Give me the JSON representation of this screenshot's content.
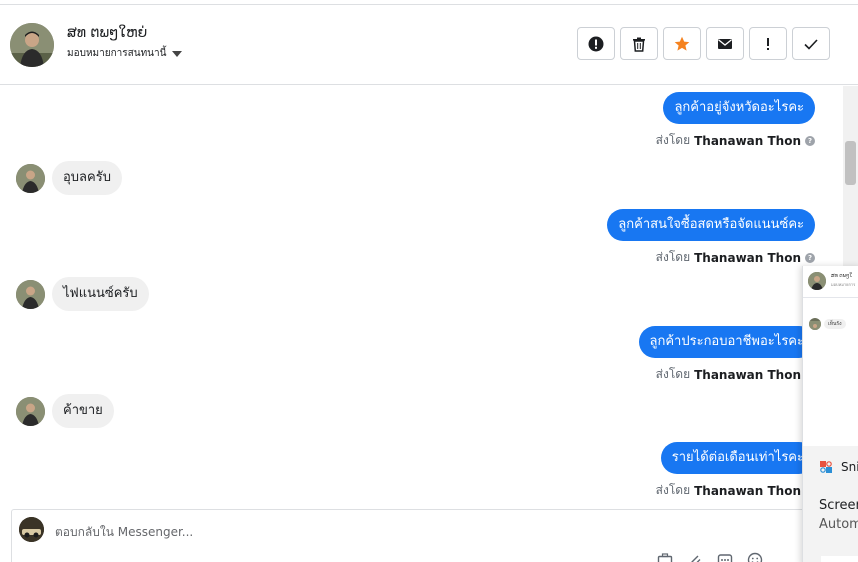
{
  "header": {
    "contact_name": "ສທ ຕພໆໃຫຍ່",
    "assign_label": "มอบหมายการสนทนานี้"
  },
  "actions": [
    {
      "name": "spam-button",
      "icon": "alert-circle-icon"
    },
    {
      "name": "delete-button",
      "icon": "trash-icon"
    },
    {
      "name": "star-button",
      "icon": "star-icon",
      "color": "#f5821f"
    },
    {
      "name": "mark-unread-button",
      "icon": "envelope-icon"
    },
    {
      "name": "follow-up-button",
      "icon": "exclamation-icon"
    },
    {
      "name": "mark-done-button",
      "icon": "check-icon"
    }
  ],
  "messages": [
    {
      "dir": "out",
      "text": "ลูกค้าอยู่จังหวัดอะไรคะ",
      "sent_prefix": "ส่งโดย",
      "sender": "Thanawan Thon"
    },
    {
      "dir": "in",
      "text": "อุบลครับ"
    },
    {
      "dir": "out",
      "text": "ลูกค้าสนใจซื้อสดหรือจัดแนนซ์คะ",
      "sent_prefix": "ส่งโดย",
      "sender": "Thanawan Thon"
    },
    {
      "dir": "in",
      "text": "ไฟแนนซ์ครับ"
    },
    {
      "dir": "out",
      "text": "ลูกค้าประกอบอาชีพอะไรคะ",
      "sent_prefix": "ส่งโดย",
      "sender": "Thanawan Thon"
    },
    {
      "dir": "in",
      "text": "ค้าขาย"
    },
    {
      "dir": "out",
      "text": "รายได้ต่อเดือนเท่าไรคะ",
      "sent_prefix": "ส่งโดย",
      "sender": "Thanawan Thon"
    }
  ],
  "composer": {
    "placeholder": "ตอบกลับใน Messenger..."
  },
  "popup": {
    "head_line1": "ສທ ຕພໆໃ",
    "head_line2": "มอบหมายการ",
    "bubble": "เห็นรัง",
    "toast_app": "Sni",
    "toast_title": "Screen",
    "toast_sub": "Autom"
  },
  "colors": {
    "outgoing_bubble": "#1877f2",
    "incoming_bubble": "#f0f0f0",
    "star": "#f5821f"
  }
}
